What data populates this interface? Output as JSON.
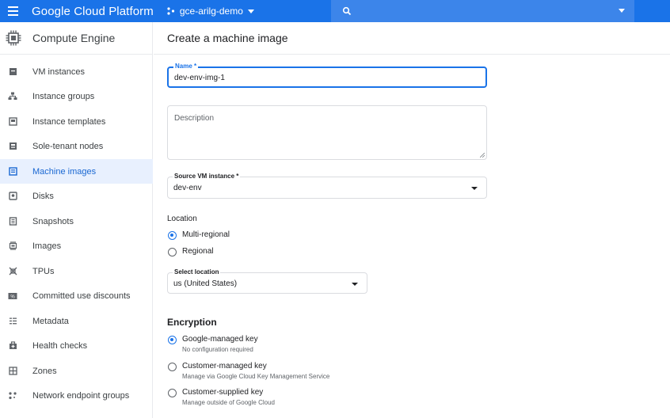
{
  "topbar": {
    "brand": "Google Cloud Platform",
    "project": "gce-arilg-demo",
    "accent": "#1a73e8"
  },
  "sidebar": {
    "title": "Compute Engine",
    "items": [
      {
        "label": "VM instances",
        "icon": "vm-icon"
      },
      {
        "label": "Instance groups",
        "icon": "groups-icon"
      },
      {
        "label": "Instance templates",
        "icon": "template-icon"
      },
      {
        "label": "Sole-tenant nodes",
        "icon": "node-icon"
      },
      {
        "label": "Machine images",
        "icon": "machine-image-icon",
        "active": true
      },
      {
        "label": "Disks",
        "icon": "disk-icon"
      },
      {
        "label": "Snapshots",
        "icon": "snapshot-icon"
      },
      {
        "label": "Images",
        "icon": "image-icon"
      },
      {
        "label": "TPUs",
        "icon": "tpu-icon"
      },
      {
        "label": "Committed use discounts",
        "icon": "discount-icon"
      },
      {
        "label": "Metadata",
        "icon": "metadata-icon"
      },
      {
        "label": "Health checks",
        "icon": "health-icon"
      },
      {
        "label": "Zones",
        "icon": "zones-icon"
      },
      {
        "label": "Network endpoint groups",
        "icon": "network-icon"
      }
    ]
  },
  "main": {
    "title": "Create a machine image",
    "name_field": {
      "label": "Name *",
      "value": "dev-env-img-1"
    },
    "description": {
      "placeholder": "Description"
    },
    "source_vm": {
      "label": "Source VM instance *",
      "value": "dev-env"
    },
    "location": {
      "label": "Location",
      "options": [
        {
          "label": "Multi-regional",
          "checked": true
        },
        {
          "label": "Regional",
          "checked": false
        }
      ],
      "select": {
        "label": "Select location",
        "value": "us (United States)"
      }
    },
    "encryption": {
      "heading": "Encryption",
      "options": [
        {
          "label": "Google-managed key",
          "sub": "No configuration required",
          "checked": true
        },
        {
          "label": "Customer-managed key",
          "sub": "Manage via Google Cloud Key Management Service",
          "checked": false
        },
        {
          "label": "Customer-supplied key",
          "sub": "Manage outside of Google Cloud",
          "checked": false
        }
      ]
    }
  }
}
